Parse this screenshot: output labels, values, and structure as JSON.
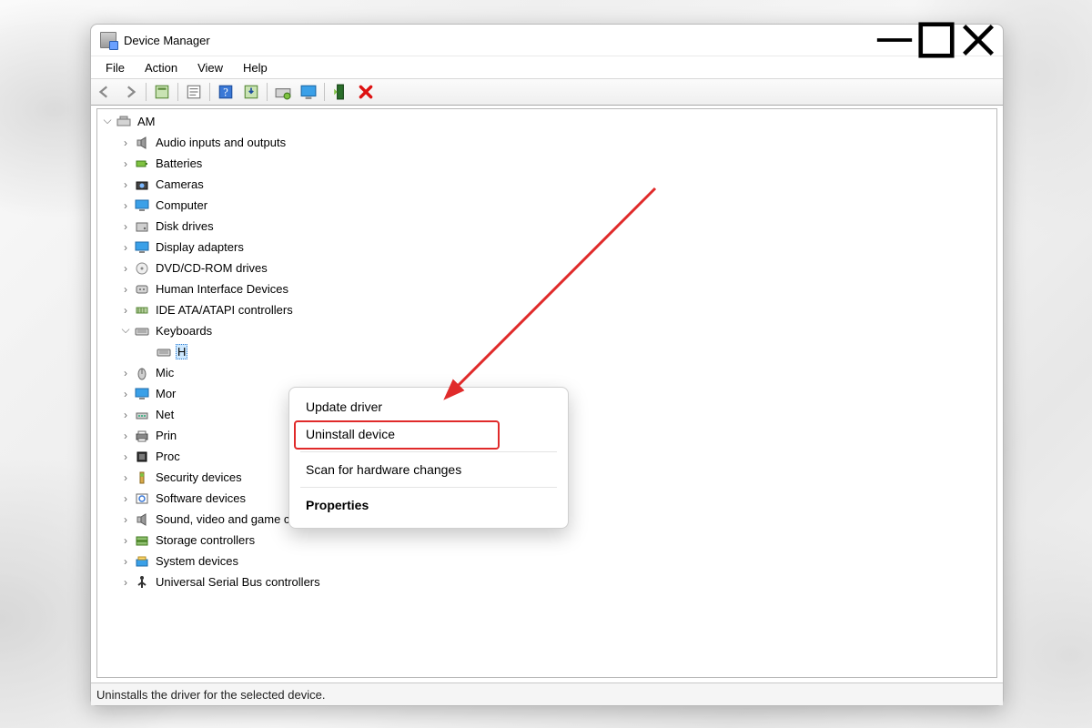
{
  "window": {
    "title": "Device Manager"
  },
  "menu": {
    "file": "File",
    "action": "Action",
    "view": "View",
    "help": "Help"
  },
  "toolbar_icons": [
    "back",
    "forward",
    "show-hidden",
    "properties",
    "help",
    "update",
    "scan",
    "monitor",
    "enable",
    "delete"
  ],
  "tree": {
    "root": "AM",
    "nodes": [
      {
        "label": "Audio inputs and outputs",
        "icon": "speaker"
      },
      {
        "label": "Batteries",
        "icon": "battery"
      },
      {
        "label": "Cameras",
        "icon": "camera"
      },
      {
        "label": "Computer",
        "icon": "monitor"
      },
      {
        "label": "Disk drives",
        "icon": "disk"
      },
      {
        "label": "Display adapters",
        "icon": "monitor"
      },
      {
        "label": "DVD/CD-ROM drives",
        "icon": "disc"
      },
      {
        "label": "Human Interface Devices",
        "icon": "hid"
      },
      {
        "label": "IDE ATA/ATAPI controllers",
        "icon": "ide"
      },
      {
        "label": "Keyboards",
        "icon": "keyboard",
        "expanded": true,
        "children": [
          {
            "label": "H",
            "icon": "keyboard",
            "selected": true
          }
        ]
      },
      {
        "label": "Mic",
        "truncated": true,
        "icon": "mouse"
      },
      {
        "label": "Mor",
        "truncated": true,
        "icon": "monitor"
      },
      {
        "label": "Net",
        "truncated": true,
        "icon": "network"
      },
      {
        "label": "Prin",
        "truncated": true,
        "icon": "printer"
      },
      {
        "label": "Proc",
        "truncated": true,
        "icon": "cpu"
      },
      {
        "label": "Security devices",
        "icon": "security"
      },
      {
        "label": "Software devices",
        "icon": "software"
      },
      {
        "label": "Sound, video and game controllers",
        "icon": "speaker"
      },
      {
        "label": "Storage controllers",
        "icon": "storage"
      },
      {
        "label": "System devices",
        "icon": "system"
      },
      {
        "label": "Universal Serial Bus controllers",
        "icon": "usb"
      }
    ]
  },
  "context_menu": {
    "update": "Update driver",
    "uninstall": "Uninstall device",
    "scan": "Scan for hardware changes",
    "properties": "Properties"
  },
  "status": "Uninstalls the driver for the selected device.",
  "annotation": {
    "highlight_item": "uninstall",
    "arrow_color": "#e02a2a"
  }
}
